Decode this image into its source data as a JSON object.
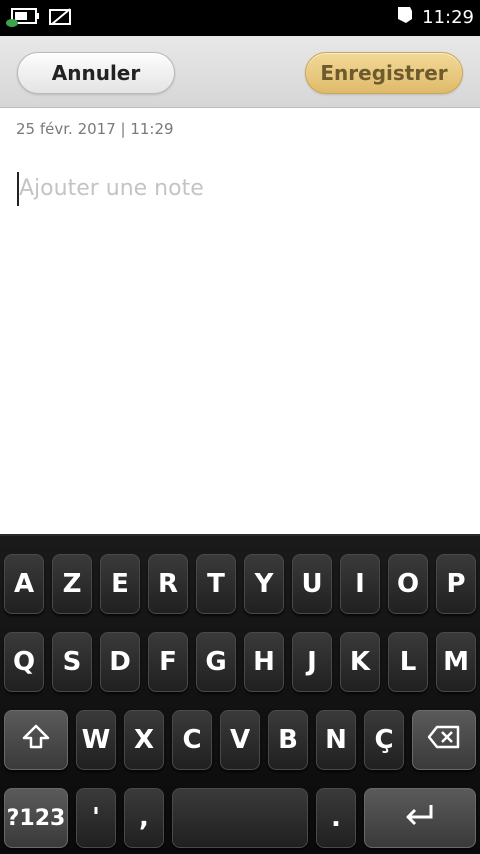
{
  "status_bar": {
    "time": "11:29",
    "icons": [
      "battery-charging-icon",
      "no-sim-icon",
      "notification-icon"
    ]
  },
  "header": {
    "cancel_label": "Annuler",
    "save_label": "Enregistrer"
  },
  "note": {
    "date": "25 févr. 2017 | 11:29",
    "placeholder": "Ajouter une note"
  },
  "keyboard": {
    "row1": [
      "A",
      "Z",
      "E",
      "R",
      "T",
      "Y",
      "U",
      "I",
      "O",
      "P"
    ],
    "row2": [
      "Q",
      "S",
      "D",
      "F",
      "G",
      "H",
      "J",
      "K",
      "L",
      "M"
    ],
    "row3": [
      "W",
      "X",
      "C",
      "V",
      "B",
      "N",
      "Ç"
    ],
    "row4": {
      "symbols": "?123",
      "apostrophe": "'",
      "comma": ",",
      "period": "."
    },
    "icons": {
      "shift": "shift-icon",
      "backspace": "backspace-icon",
      "enter": "enter-icon"
    }
  }
}
